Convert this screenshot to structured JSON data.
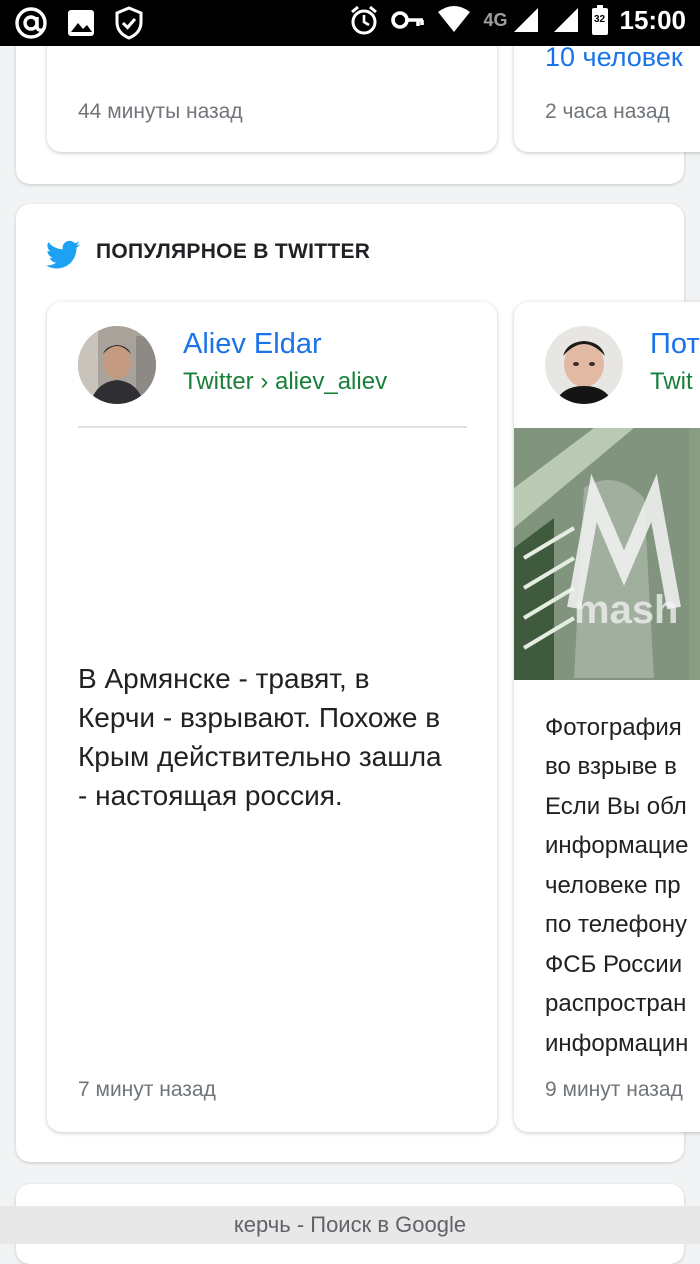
{
  "status_bar": {
    "time": "15:00",
    "network": "4G",
    "battery": "32",
    "icons_left": [
      "at-icon",
      "image-icon",
      "shield-check-icon"
    ],
    "icons_right": [
      "alarm-icon",
      "key-icon",
      "wifi-icon",
      "signal-icon"
    ]
  },
  "top_cards": {
    "card1": {
      "time": "44 минуты назад"
    },
    "card2": {
      "title_fragment": "10 человек",
      "time": "2 часа назад"
    }
  },
  "twitter_section": {
    "title": "ПОПУЛЯРНОЕ В TWITTER",
    "cards": [
      {
        "author": "Aliev Eldar",
        "source": "Twitter › aliev_aliev",
        "text": "В Армянске - травят, в Керчи - взрывают. Похоже в Крым действительно зашла - настоящая россия.",
        "time": "7 минут назад"
      },
      {
        "author": "Пот",
        "source": "Twit",
        "media_watermark": "mash",
        "text_lines": [
          "Фотография",
          "во взрыве в",
          "Если Вы обл",
          "информацие",
          "человеке пр",
          "по телефону",
          "ФСБ России",
          "распростран",
          "информацин"
        ],
        "time": "9 минут назад"
      }
    ]
  },
  "bottom_bar": {
    "text": "керчь - Поиск в Google"
  },
  "colors": {
    "link": "#1a73e8",
    "source": "#188038",
    "twitter_blue": "#1da1f2"
  }
}
